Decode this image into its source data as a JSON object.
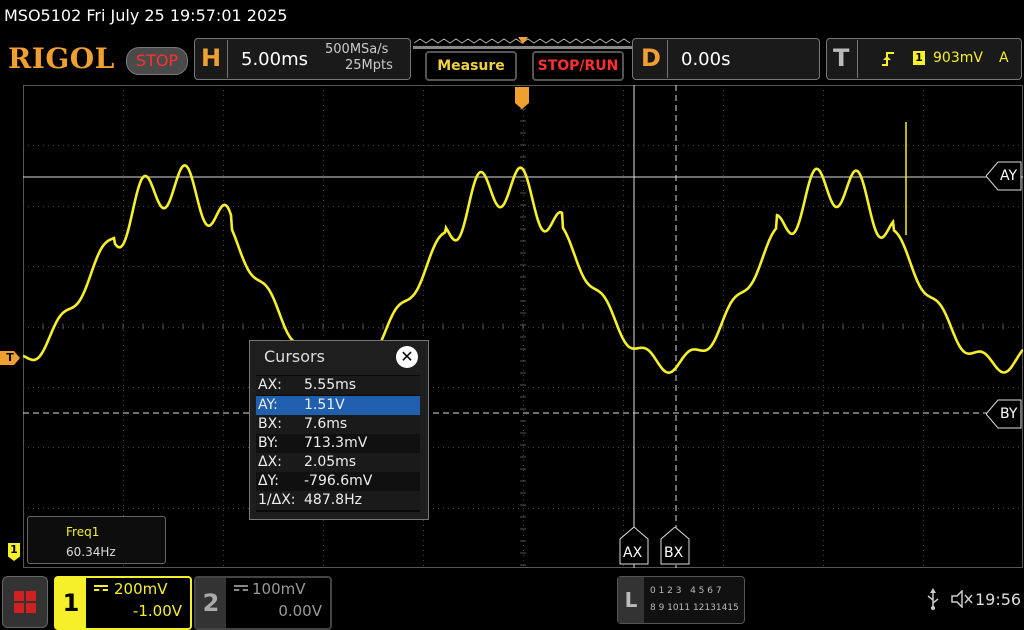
{
  "title": "MSO5102  Fri July 25 19:57:01 2025",
  "logo": "RIGOL",
  "status_button": "STOP",
  "horizontal": {
    "letter": "H",
    "timebase": "5.00ms",
    "sample_rate": "500MSa/s",
    "memory_depth": "25Mpts"
  },
  "buttons": {
    "measure": "Measure",
    "stop_run": "STOP/RUN"
  },
  "delay": {
    "letter": "D",
    "value": "0.00s"
  },
  "trigger": {
    "letter": "T",
    "channel": "1",
    "level": "903mV",
    "mode": "A"
  },
  "cursor_labels": {
    "ay": "AY",
    "by": "BY",
    "ax": "AX",
    "bx": "BX"
  },
  "cursors_window": {
    "title": "Cursors",
    "close": "✕",
    "rows": [
      {
        "key": "AX:",
        "value": "5.55ms"
      },
      {
        "key": "AY:",
        "value": "1.51V"
      },
      {
        "key": "BX:",
        "value": "7.6ms"
      },
      {
        "key": "BY:",
        "value": "713.3mV"
      },
      {
        "key": "ΔX:",
        "value": "2.05ms"
      },
      {
        "key": "ΔY:",
        "value": "-796.6mV"
      },
      {
        "key": "1/ΔX:",
        "value": "487.8Hz"
      }
    ],
    "selected_row": 1
  },
  "measurement": {
    "name": "Freq1",
    "value": "60.34Hz"
  },
  "channel_markers": {
    "ch1": "1",
    "trigger_marker": "T"
  },
  "ch1": {
    "number": "1",
    "scale": "200mV",
    "offset": "-1.00V",
    "color": "#f5f02a"
  },
  "ch2": {
    "number": "2",
    "scale": "100mV",
    "offset": "0.00V"
  },
  "logic": {
    "letter": "L",
    "row1": "0 1 2 3   4 5 6 7",
    "row2": "8 9 1011 12131415"
  },
  "clock": "19:56",
  "icons": {
    "usb": "usb-icon",
    "speaker": "speaker-muted-icon"
  },
  "colors": {
    "trace": "#f5f02a",
    "accent": "#f0a030",
    "stop_red": "#ff3030"
  }
}
